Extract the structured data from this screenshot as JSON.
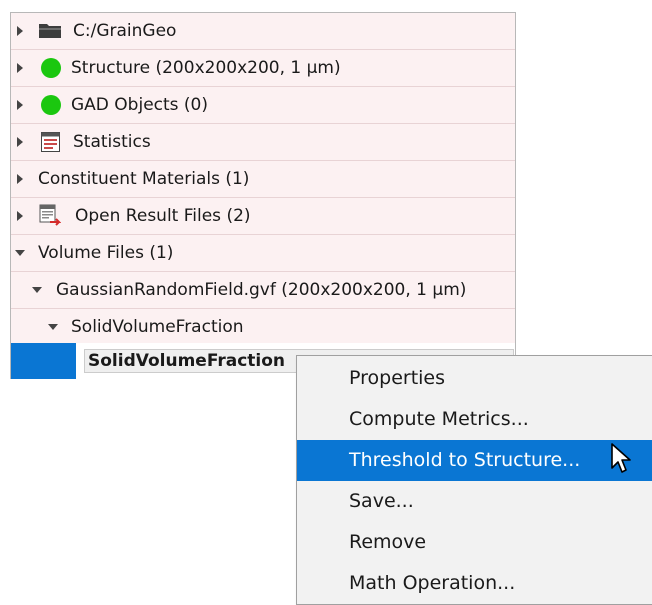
{
  "tree": {
    "items": [
      {
        "label": "C:/GrainGeo",
        "icon": "folder-icon"
      },
      {
        "label": "Structure (200x200x200, 1 µm)",
        "icon": "green-dot-icon",
        "color": "#1bc70f"
      },
      {
        "label": "GAD Objects (0)",
        "icon": "green-dot-icon",
        "color": "#1bc70f"
      },
      {
        "label": "Statistics",
        "icon": "statistics-icon"
      },
      {
        "label": "Constituent Materials (1)"
      },
      {
        "label": "Open Result Files (2)",
        "icon": "result-files-icon"
      },
      {
        "label": "Volume Files (1)"
      },
      {
        "label": "GaussianRandomField.gvf (200x200x200, 1 µm)"
      },
      {
        "label": "SolidVolumeFraction"
      },
      {
        "label": "SolidVolumeFraction"
      }
    ]
  },
  "context_menu": {
    "items": [
      "Properties",
      "Compute Metrics...",
      "Threshold to Structure...",
      "Save...",
      "Remove",
      "Math Operation..."
    ],
    "highlighted": "Threshold to Structure..."
  },
  "colors": {
    "selection": "#0a76d3",
    "row_background": "#fcf1f2",
    "status_green": "#1bc70f"
  }
}
